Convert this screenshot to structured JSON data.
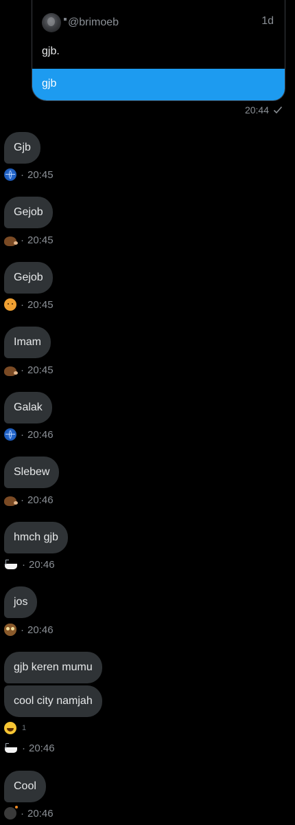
{
  "quote": {
    "handle": "@brimoeb",
    "age": "1d",
    "text": "gjb.",
    "reply": "gjb"
  },
  "sent": {
    "time": "20:44",
    "status_icon": "check-icon"
  },
  "messages": [
    {
      "text": "Gjb",
      "reaction_icon": "globe-icon",
      "time": "20:45"
    },
    {
      "text": "Gejob",
      "reaction_icon": "hedgehog-icon",
      "time": "20:45"
    },
    {
      "text": "Gejob",
      "reaction_icon": "dog-face-icon",
      "time": "20:45"
    },
    {
      "text": "Imam",
      "reaction_icon": "hedgehog-icon",
      "time": "20:45"
    },
    {
      "text": "Galak",
      "reaction_icon": "globe-icon",
      "time": "20:46"
    },
    {
      "text": "Slebew",
      "reaction_icon": "hedgehog-icon",
      "time": "20:46"
    },
    {
      "text": "hmch gjb",
      "reaction_icon": "bathtub-icon",
      "time": "20:46"
    },
    {
      "text": "jos",
      "reaction_icon": "owl-icon",
      "time": "20:46"
    }
  ],
  "group": {
    "texts": [
      "gjb keren mumu",
      "cool city namjah"
    ],
    "reaction": {
      "icon": "laughing-face-icon",
      "count": "1"
    },
    "reaction_icon": "bathtub-icon",
    "time": "20:46"
  },
  "last": {
    "text": "Cool",
    "reaction_icon": "bomb-icon",
    "time": "20:46"
  },
  "separator": "·"
}
